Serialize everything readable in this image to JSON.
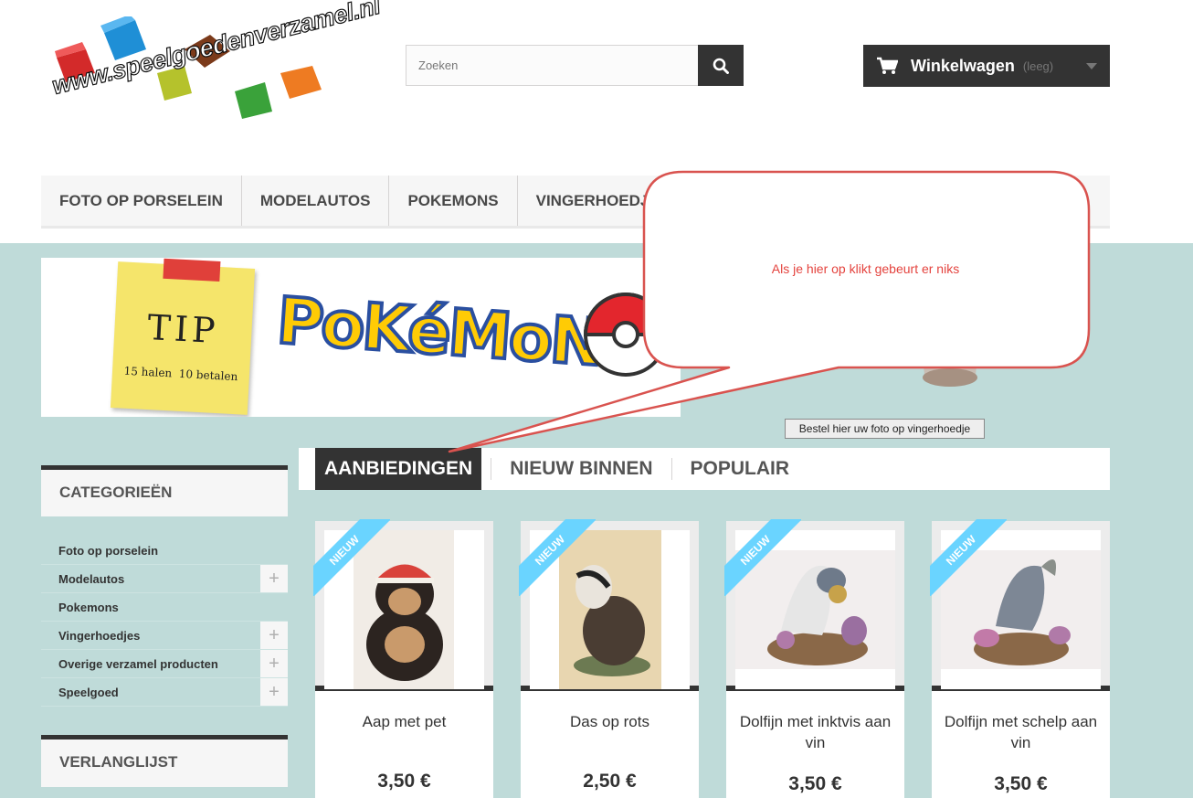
{
  "header": {
    "logo_text": "www.speelgoedenverzamel.nl",
    "search_placeholder": "Zoeken",
    "cart_title": "Winkelwagen",
    "cart_status": "(leeg)"
  },
  "menu": {
    "items": [
      "FOTO OP PORSELEIN",
      "MODELAUTOS",
      "POKEMONS",
      "VINGERHOEDJES"
    ]
  },
  "banner": {
    "note_title": "TIP",
    "note_sub": "15 halen  10 betalen",
    "brand": "PoKéMoN",
    "foto_button": "Bestel hier uw foto op vingerhoedje"
  },
  "categories": {
    "title": "CATEGORIEËN",
    "items": [
      {
        "label": "Foto op porselein",
        "expandable": false
      },
      {
        "label": "Modelautos",
        "expandable": true
      },
      {
        "label": "Pokemons",
        "expandable": false
      },
      {
        "label": "Vingerhoedjes",
        "expandable": true
      },
      {
        "label": "Overige verzamel producten",
        "expandable": true
      },
      {
        "label": "Speelgoed",
        "expandable": true
      }
    ],
    "plus": "+"
  },
  "wishlist": {
    "title": "VERLANGLIJST"
  },
  "tabs": [
    "AANBIEDINGEN",
    "NIEUW BINNEN",
    "POPULAIR"
  ],
  "products": [
    {
      "ribbon": "NIEUW",
      "name": "Aap met pet",
      "price": "3,50 €"
    },
    {
      "ribbon": "NIEUW",
      "name": "Das op rots",
      "price": "2,50 €"
    },
    {
      "ribbon": "NIEUW",
      "name": "Dolfijn met inktvis aan vin",
      "price": "3,50 €"
    },
    {
      "ribbon": "NIEUW",
      "name": "Dolfijn met schelp aan vin",
      "price": "3,50 €"
    }
  ],
  "callout": {
    "text": "Als je hier op klikt gebeurt er niks",
    "color": "#e4433e"
  }
}
